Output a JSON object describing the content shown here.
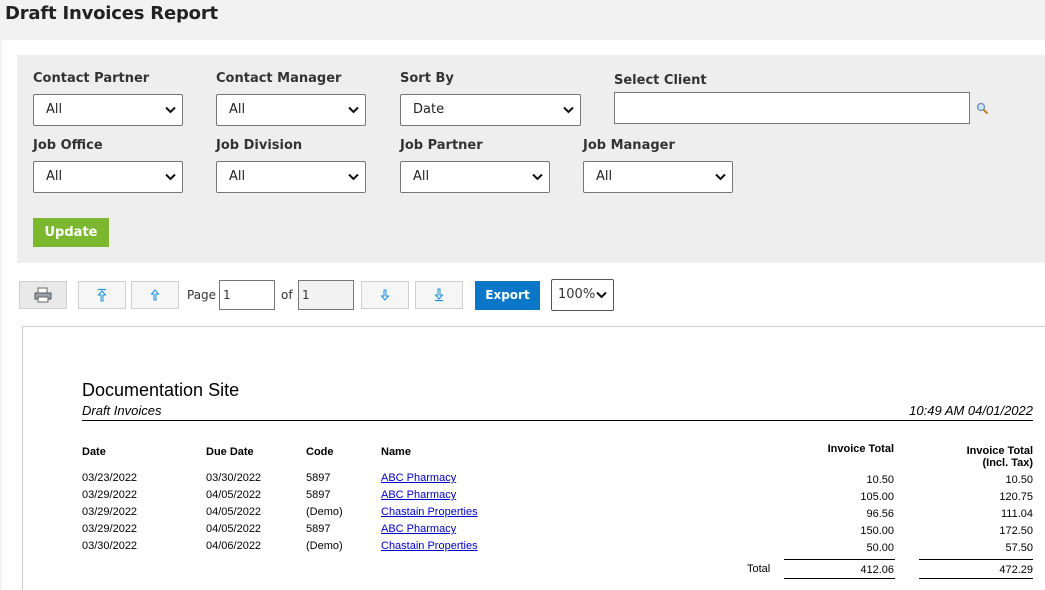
{
  "page": {
    "title": "Draft Invoices Report"
  },
  "filters": {
    "contact_partner": {
      "label": "Contact Partner",
      "value": "All"
    },
    "contact_manager": {
      "label": "Contact Manager",
      "value": "All"
    },
    "sort_by": {
      "label": "Sort By",
      "value": "Date"
    },
    "select_client": {
      "label": "Select Client",
      "value": ""
    },
    "job_office": {
      "label": "Job Office",
      "value": "All"
    },
    "job_division": {
      "label": "Job Division",
      "value": "All"
    },
    "job_partner": {
      "label": "Job Partner",
      "value": "All"
    },
    "job_manager": {
      "label": "Job Manager",
      "value": "All"
    },
    "update_label": "Update"
  },
  "toolbar": {
    "page_label": "Page",
    "page_value": "1",
    "of_label": "of",
    "total_pages": "1",
    "export_label": "Export",
    "zoom": "100%",
    "icons": [
      "printer-icon",
      "first-page-icon",
      "previous-page-icon",
      "next-page-icon",
      "last-page-icon"
    ]
  },
  "report": {
    "organization": "Documentation Site",
    "subtitle": "Draft Invoices",
    "timestamp": "10:49 AM 04/01/2022",
    "columns": {
      "date": "Date",
      "due_date": "Due Date",
      "code": "Code",
      "name": "Name",
      "invoice_total": "Invoice Total",
      "invoice_total_incl_line1": "Invoice Total",
      "invoice_total_incl_line2": "(Incl. Tax)"
    },
    "rows": [
      {
        "date": "03/23/2022",
        "due_date": "03/30/2022",
        "code": "5897",
        "name": "ABC Pharmacy",
        "invoice_total": "10.50",
        "invoice_total_incl_tax": "10.50"
      },
      {
        "date": "03/29/2022",
        "due_date": "04/05/2022",
        "code": "5897",
        "name": "ABC Pharmacy",
        "invoice_total": "105.00",
        "invoice_total_incl_tax": "120.75"
      },
      {
        "date": "03/29/2022",
        "due_date": "04/05/2022",
        "code": "(Demo)",
        "name": "Chastain Properties",
        "invoice_total": "96.56",
        "invoice_total_incl_tax": "111.04"
      },
      {
        "date": "03/29/2022",
        "due_date": "04/05/2022",
        "code": "5897",
        "name": "ABC Pharmacy",
        "invoice_total": "150.00",
        "invoice_total_incl_tax": "172.50"
      },
      {
        "date": "03/30/2022",
        "due_date": "04/06/2022",
        "code": "(Demo)",
        "name": "Chastain Properties",
        "invoice_total": "50.00",
        "invoice_total_incl_tax": "57.50"
      }
    ],
    "total_label": "Total",
    "total_invoice": "412.06",
    "total_invoice_incl_tax": "472.29"
  },
  "colors": {
    "update_button": "#7cb82f",
    "export_button": "#0a76c8",
    "link": "#0000cc",
    "nav_arrow": "#1a8fdc"
  }
}
